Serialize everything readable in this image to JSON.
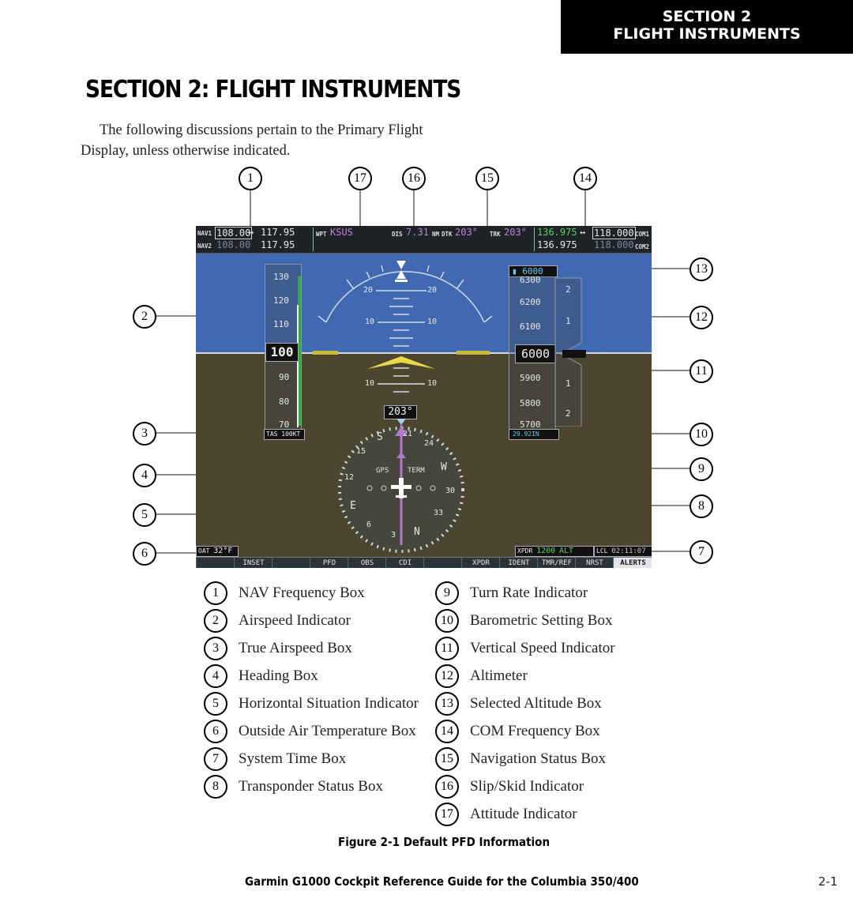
{
  "header_tab": {
    "line1": "SECTION 2",
    "line2": "FLIGHT INSTRUMENTS"
  },
  "page_title": "SECTION 2: FLIGHT INSTRUMENTS",
  "intro": "The following discussions pertain to the Primary Flight Display, unless otherwise indicated.",
  "figure": {
    "callouts": [
      "1",
      "2",
      "3",
      "4",
      "5",
      "6",
      "7",
      "8",
      "9",
      "10",
      "11",
      "12",
      "13",
      "14",
      "15",
      "16",
      "17"
    ],
    "pfd": {
      "nav1_label": "NAV1",
      "nav1_active": "108.00",
      "nav1_arrow": "↔",
      "nav1_standby": "117.95",
      "nav2_label": "NAV2",
      "nav2_active": "108.00",
      "nav2_standby": "117.95",
      "wpt_label": "WPT",
      "wpt_value": "KSUS",
      "dis_label": "DIS",
      "dis_value": "7.31",
      "dis_unit": "NM",
      "dtk_label": "DTK",
      "dtk_value": "203°",
      "trk_label": "TRK",
      "trk_value": "203°",
      "com1_active": "136.975",
      "com1_arrow": "↔",
      "com1_standby": "118.000",
      "com1_label": "COM1",
      "com2_active": "136.975",
      "com2_standby": "118.000",
      "com2_label": "COM2",
      "airspeed_ticks": [
        "130",
        "120",
        "110",
        "90",
        "80",
        "70"
      ],
      "airspeed_current": "100",
      "tas_label": "TAS",
      "tas_value": "100KT",
      "pitch_labels": [
        "20",
        "20",
        "10",
        "10",
        "10",
        "10"
      ],
      "selected_altitude": "6000",
      "altitude_ticks": [
        "6300",
        "6200",
        "6100",
        "5900",
        "5800",
        "5700"
      ],
      "altitude_current": "6000",
      "vsi_ticks": [
        "2",
        "1",
        "1",
        "2"
      ],
      "baro_setting": "29.92IN",
      "heading_value": "203°",
      "compass_labels": [
        "S",
        "15",
        "12",
        "E",
        "6",
        "3",
        "N",
        "33",
        "30",
        "W",
        "24",
        "21"
      ],
      "gps_label": "GPS",
      "term_label": "TERM",
      "oat_label": "OAT",
      "oat_value": "32°F",
      "xpdr_label": "XPDR",
      "xpdr_code": "1200",
      "xpdr_mode": "ALT",
      "lcl_label": "LCL",
      "lcl_time": "02:11:07",
      "softkeys": [
        "INSET",
        "PFD",
        "OBS",
        "CDI",
        "XPDR",
        "IDENT",
        "TMR/REF",
        "NRST",
        "ALERTS"
      ]
    }
  },
  "legend": [
    {
      "num": "1",
      "label": "NAV Frequency Box"
    },
    {
      "num": "2",
      "label": "Airspeed Indicator"
    },
    {
      "num": "3",
      "label": "True Airspeed Box"
    },
    {
      "num": "4",
      "label": "Heading Box"
    },
    {
      "num": "5",
      "label": "Horizontal Situation Indicator"
    },
    {
      "num": "6",
      "label": "Outside Air Temperature Box"
    },
    {
      "num": "7",
      "label": "System Time Box"
    },
    {
      "num": "8",
      "label": "Transponder Status Box"
    },
    {
      "num": "9",
      "label": "Turn Rate Indicator"
    },
    {
      "num": "10",
      "label": "Barometric Setting Box"
    },
    {
      "num": "11",
      "label": "Vertical Speed Indicator"
    },
    {
      "num": "12",
      "label": "Altimeter"
    },
    {
      "num": "13",
      "label": "Selected Altitude Box"
    },
    {
      "num": "14",
      "label": "COM Frequency Box"
    },
    {
      "num": "15",
      "label": "Navigation Status Box"
    },
    {
      "num": "16",
      "label": "Slip/Skid Indicator"
    },
    {
      "num": "17",
      "label": "Attitude Indicator"
    }
  ],
  "figure_caption": "Figure 2-1  Default PFD Information",
  "footer": {
    "title": "Garmin G1000 Cockpit Reference Guide for the Columbia 350/400",
    "page": "2-1"
  }
}
